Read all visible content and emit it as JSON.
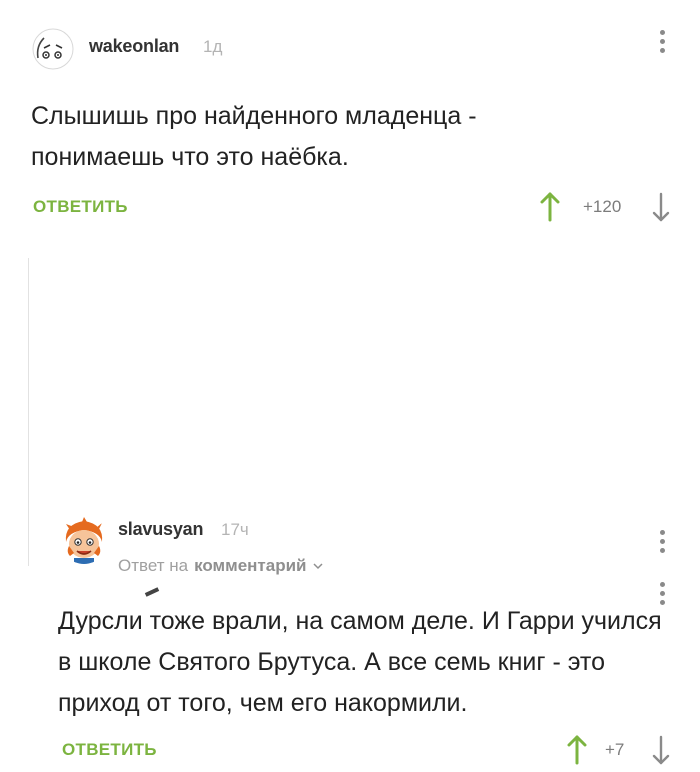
{
  "comments": [
    {
      "username": "wakeonlan",
      "time": "1д",
      "text": "Слышишь про найденного младенца - понимаешь что это наёбка.",
      "reply_label": "ОТВЕТИТЬ",
      "rating": "+120",
      "avatar_icon": "sad-face-sketch-icon"
    },
    {
      "username": "slavusyan",
      "time": "17ч",
      "reply_to_prefix": "Ответ на",
      "reply_to_link": "комментарий",
      "text": "Дурсли тоже врали, на самом деле. И Гарри учился в школе Святого Брутуса. А все семь книг - это приход от того, чем его накормили.",
      "reply_label": "ОТВЕТИТЬ",
      "rating": "+7",
      "avatar_icon": "red-haired-boy-cartoon-icon"
    }
  ],
  "colors": {
    "accent_green": "#7cb440",
    "rating_gray": "#7c7c7c",
    "time_gray": "#b4b4b4"
  }
}
